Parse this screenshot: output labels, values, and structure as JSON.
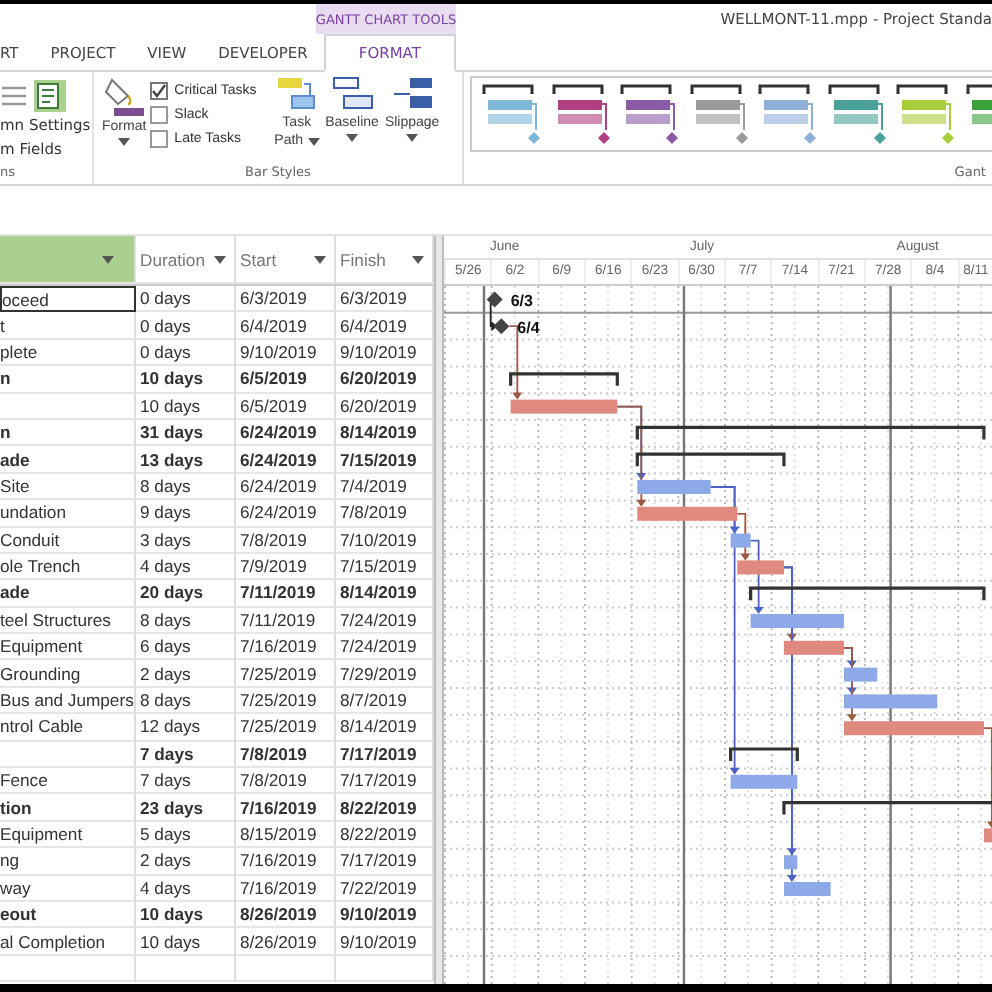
{
  "title_bar": {
    "context_tab": "GANTT CHART TOOLS",
    "title": "WELLMONT-11.mpp - Project Standa"
  },
  "tabs": [
    {
      "label": "RT",
      "selected": false
    },
    {
      "label": "PROJECT",
      "selected": false
    },
    {
      "label": "VIEW",
      "selected": false
    },
    {
      "label": "DEVELOPER",
      "selected": false
    },
    {
      "label": "FORMAT",
      "selected": true
    }
  ],
  "ribbon": {
    "columns_group": {
      "settings": "mn Settings",
      "fields": "m Fields",
      "label": "ns"
    },
    "bar_styles": {
      "format": "Format",
      "checkboxes": [
        {
          "label": "Critical Tasks",
          "checked": true
        },
        {
          "label": "Slack",
          "checked": false
        },
        {
          "label": "Late Tasks",
          "checked": false
        }
      ],
      "task_path": [
        "Task",
        "Path"
      ],
      "baseline": "Baseline",
      "slippage": "Slippage",
      "label": "Bar Styles"
    },
    "gantt_style": {
      "label": "Gant",
      "styles": [
        {
          "color": "#7fb7d8"
        },
        {
          "color": "#b0407f"
        },
        {
          "color": "#8a5ca8"
        },
        {
          "color": "#9a9a9a"
        },
        {
          "color": "#8eb0d8"
        },
        {
          "color": "#4aa19a"
        },
        {
          "color": "#a8cc3a"
        },
        {
          "color": "#3aa03a"
        }
      ]
    }
  },
  "table": {
    "columns": [
      "Duration",
      "Start",
      "Finish"
    ],
    "rows": [
      {
        "name": "oceed",
        "duration": "0 days",
        "start": "6/3/2019",
        "finish": "6/3/2019",
        "kind": "milestone",
        "selected": true,
        "bar_label": "6/3"
      },
      {
        "name": "t",
        "duration": "0 days",
        "start": "6/4/2019",
        "finish": "6/4/2019",
        "kind": "milestone",
        "selected": false,
        "bar_label": "6/4"
      },
      {
        "name": "plete",
        "duration": "0 days",
        "start": "9/10/2019",
        "finish": "9/10/2019",
        "kind": "milestone",
        "selected": false
      },
      {
        "name": "n",
        "duration": "10 days",
        "start": "6/5/2019",
        "finish": "6/20/2019",
        "kind": "summary",
        "selected": false
      },
      {
        "duration": "10 days",
        "start": "6/5/2019",
        "finish": "6/20/2019",
        "kind": "critical",
        "selected": false
      },
      {
        "name": "n",
        "duration": "31 days",
        "start": "6/24/2019",
        "finish": "8/14/2019",
        "kind": "summary",
        "selected": false
      },
      {
        "name": "ade",
        "duration": "13 days",
        "start": "6/24/2019",
        "finish": "7/15/2019",
        "kind": "summary",
        "selected": false
      },
      {
        "name": "Site",
        "duration": "8 days",
        "start": "6/24/2019",
        "finish": "7/4/2019",
        "kind": "task",
        "selected": false
      },
      {
        "name": "undation",
        "duration": "9 days",
        "start": "6/24/2019",
        "finish": "7/8/2019",
        "kind": "critical",
        "selected": false
      },
      {
        "name": "Conduit",
        "duration": "3 days",
        "start": "7/8/2019",
        "finish": "7/10/2019",
        "kind": "task",
        "selected": false
      },
      {
        "name": "ole Trench",
        "duration": "4 days",
        "start": "7/9/2019",
        "finish": "7/15/2019",
        "kind": "critical",
        "selected": false
      },
      {
        "name": "ade",
        "duration": "20 days",
        "start": "7/11/2019",
        "finish": "8/14/2019",
        "kind": "summary",
        "selected": false
      },
      {
        "name": "teel Structures",
        "duration": "8 days",
        "start": "7/11/2019",
        "finish": "7/24/2019",
        "kind": "task",
        "selected": false
      },
      {
        "name": "Equipment",
        "duration": "6 days",
        "start": "7/16/2019",
        "finish": "7/24/2019",
        "kind": "critical",
        "selected": false
      },
      {
        "name": "Grounding",
        "duration": "2 days",
        "start": "7/25/2019",
        "finish": "7/29/2019",
        "kind": "task",
        "selected": false
      },
      {
        "name": "Bus and Jumpers",
        "duration": "8 days",
        "start": "7/25/2019",
        "finish": "8/7/2019",
        "kind": "task",
        "selected": false
      },
      {
        "name": "ntrol Cable",
        "duration": "12 days",
        "start": "7/25/2019",
        "finish": "8/14/2019",
        "kind": "critical",
        "selected": false
      },
      {
        "duration": "7 days",
        "start": "7/8/2019",
        "finish": "7/17/2019",
        "kind": "summary",
        "selected": false
      },
      {
        "name": "Fence",
        "duration": "7 days",
        "start": "7/8/2019",
        "finish": "7/17/2019",
        "kind": "task",
        "selected": false
      },
      {
        "name": "tion",
        "duration": "23 days",
        "start": "7/16/2019",
        "finish": "8/22/2019",
        "kind": "summary",
        "selected": false
      },
      {
        "name": "Equipment",
        "duration": "5 days",
        "start": "8/15/2019",
        "finish": "8/22/2019",
        "kind": "critical",
        "selected": false
      },
      {
        "name": "ng",
        "duration": "2 days",
        "start": "7/16/2019",
        "finish": "7/17/2019",
        "kind": "task",
        "selected": false
      },
      {
        "name": "way",
        "duration": "4 days",
        "start": "7/16/2019",
        "finish": "7/22/2019",
        "kind": "task",
        "selected": false
      },
      {
        "name": "eout",
        "duration": "10 days",
        "start": "8/26/2019",
        "finish": "9/10/2019",
        "kind": "summary",
        "selected": false
      },
      {
        "name": "al Completion",
        "duration": "10 days",
        "start": "8/26/2019",
        "finish": "9/10/2019",
        "kind": "task",
        "selected": false
      }
    ]
  },
  "timescale": {
    "months": [
      "June",
      "July",
      "August"
    ],
    "weeks": [
      "5/26",
      "6/2",
      "6/9",
      "6/16",
      "6/23",
      "6/30",
      "7/7",
      "7/14",
      "7/21",
      "7/28",
      "8/4",
      "8/11"
    ]
  }
}
